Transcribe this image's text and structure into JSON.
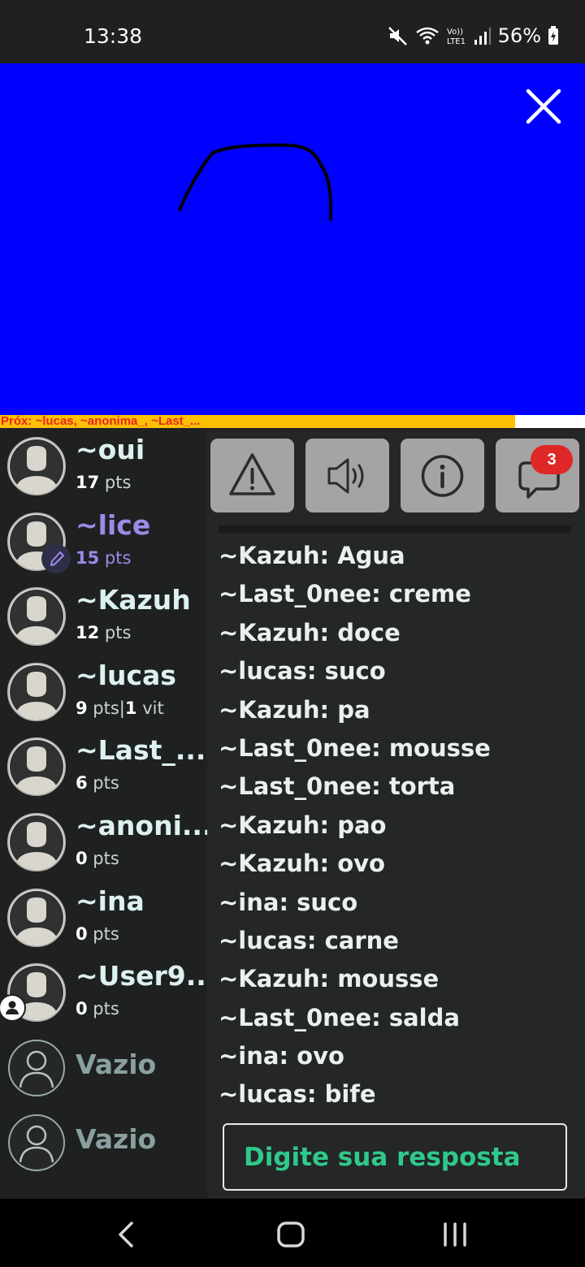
{
  "status": {
    "time": "13:38",
    "battery": "56%",
    "icons": [
      "mute-icon",
      "wifi-icon",
      "volte-icon",
      "signal-icon",
      "battery-icon"
    ]
  },
  "canvas": {
    "background_color": "#0000fe",
    "close_icon": "close-icon"
  },
  "next_turn": {
    "text": "Próx: ~lucas, ~anonima_, ~Last_...",
    "progress": 0.88
  },
  "players": [
    {
      "name": "~oui",
      "score": "17",
      "score_unit": " pts",
      "drawing": false,
      "empty": false
    },
    {
      "name": "~lice",
      "score": "15",
      "score_unit": " pts",
      "drawing": true,
      "empty": false
    },
    {
      "name": "~Kazuh",
      "score": "12",
      "score_unit": " pts",
      "drawing": false,
      "empty": false
    },
    {
      "name": "~lucas",
      "score": "9",
      "score_unit": " pts|",
      "wins": "1",
      "wins_unit": " vit",
      "drawing": false,
      "empty": false
    },
    {
      "name": "~Last_...",
      "score": "6",
      "score_unit": " pts",
      "drawing": false,
      "empty": false
    },
    {
      "name": "~anoni...",
      "score": "0",
      "score_unit": " pts",
      "drawing": false,
      "empty": false
    },
    {
      "name": "~ina",
      "score": "0",
      "score_unit": " pts",
      "drawing": false,
      "empty": false
    },
    {
      "name": "~User9...",
      "score": "0",
      "score_unit": " pts",
      "drawing": false,
      "empty": false,
      "you": true
    },
    {
      "name": "Vazio",
      "empty": true
    },
    {
      "name": "Vazio",
      "empty": true
    }
  ],
  "toolbar": {
    "buttons": [
      "report-icon",
      "sound-icon",
      "info-icon",
      "chat-icon"
    ],
    "chat_badge": "3"
  },
  "chat": [
    "~Kazuh: Agua",
    "~Last_0nee: creme",
    "~Kazuh: doce",
    "~lucas: suco",
    "~Kazuh: pa",
    "~Last_0nee: mousse",
    "~Last_0nee: torta",
    "~Kazuh: pao",
    "~Kazuh: ovo",
    "~ina: suco",
    "~lucas: carne",
    "~Kazuh: mousse",
    "~Last_0nee: salda",
    "~ina: ovo",
    "~lucas: bife"
  ],
  "answer": {
    "placeholder": "Digite sua resposta"
  },
  "colors": {
    "accent_green": "#2fc98a",
    "drawer_purple": "#9d8ae8",
    "badge_red": "#e02727",
    "next_bar": "#fdc006"
  }
}
